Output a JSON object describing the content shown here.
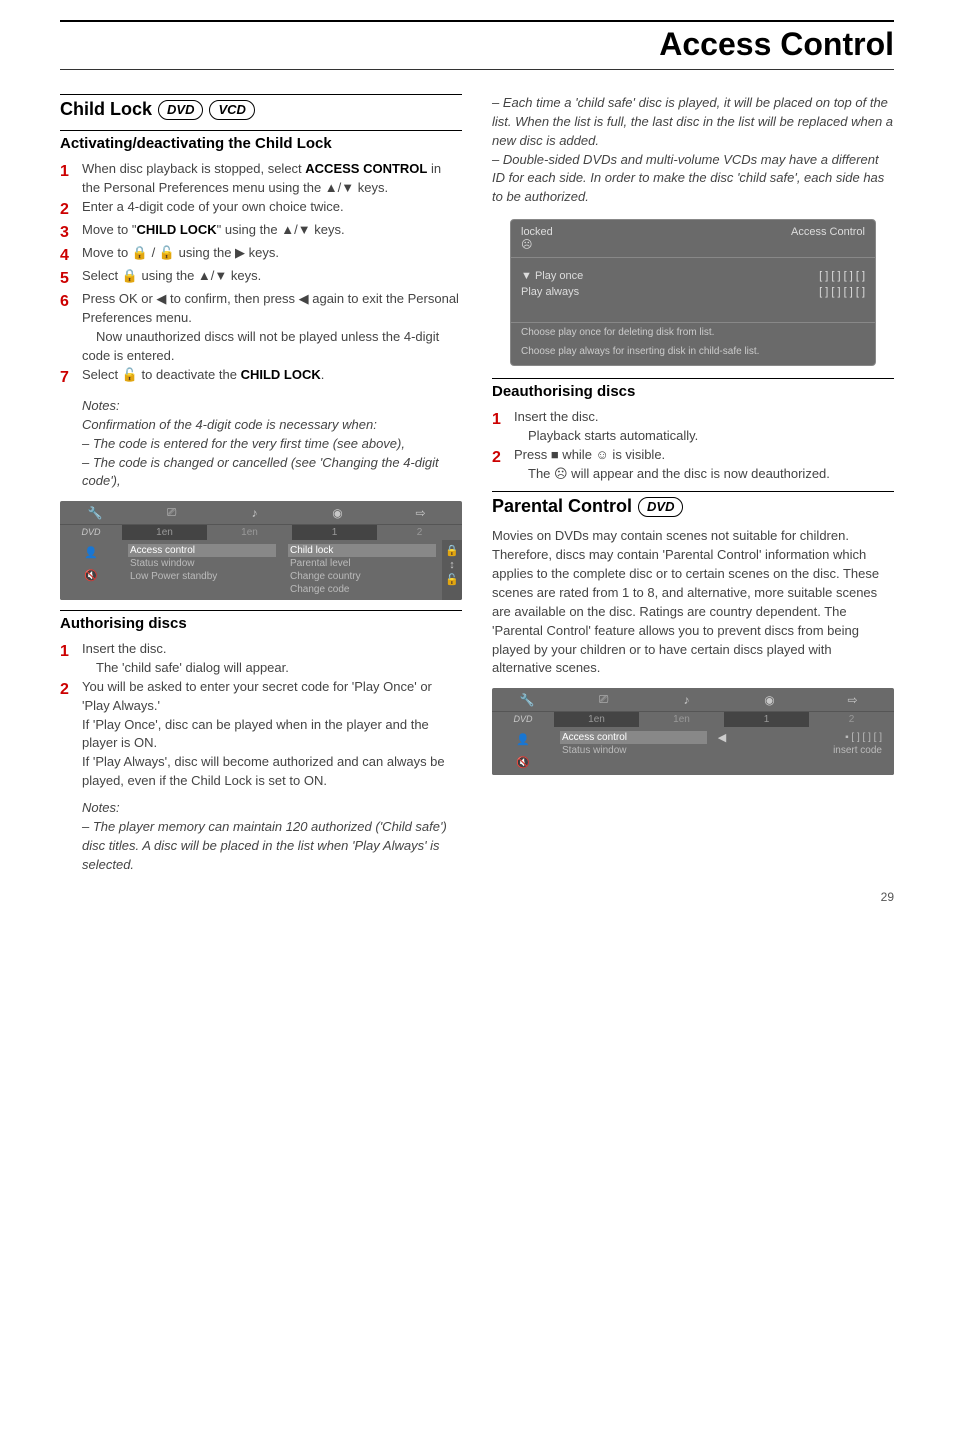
{
  "header": {
    "title": "Access Control"
  },
  "left": {
    "h2": "Child Lock",
    "badges": [
      "DVD",
      "VCD"
    ],
    "h3a": "Activating/deactivating the Child Lock",
    "steps_a": [
      {
        "n": "1",
        "pre": "When disc playback is stopped, select ",
        "b1": "ACCESS CONTROL",
        "post": " in the Personal Preferences menu using the ▲/▼ keys."
      },
      {
        "n": "2",
        "pre": "Enter a 4-digit code of your own choice twice.",
        "b1": "",
        "post": ""
      },
      {
        "n": "3",
        "pre": "Move to \"",
        "b1": "CHILD LOCK",
        "post": "\" using the ▲/▼ keys."
      },
      {
        "n": "4",
        "pre": "Move to 🔒 / 🔓 using the ▶ keys.",
        "b1": "",
        "post": ""
      },
      {
        "n": "5",
        "pre": "Select 🔒 using the ▲/▼ keys.",
        "b1": "",
        "post": ""
      },
      {
        "n": "6",
        "pre": "Press OK or ◀ to confirm, then press ◀ again to exit the Personal Preferences menu.",
        "b1": "",
        "post": "",
        "extra": "Now unauthorized discs will not be played unless the 4-digit code is entered."
      },
      {
        "n": "7",
        "pre": "Select 🔓 to deactivate the ",
        "b1": "CHILD LOCK",
        "post": "."
      }
    ],
    "notes_a_title": "Notes:",
    "notes_a": [
      "Confirmation of the 4-digit code is necessary when:",
      "– The code is entered for the very first time (see above),",
      "– The code is changed or cancelled (see 'Changing the 4-digit code'),"
    ],
    "menu1": {
      "tabs": [
        "1en",
        "1en",
        "1",
        "2"
      ],
      "mid": [
        "Access control",
        "Status window",
        "Low Power standby"
      ],
      "right": [
        "Child lock",
        "Parental level",
        "Change country",
        "Change code"
      ]
    },
    "h3b": "Authorising discs",
    "steps_b": [
      {
        "n": "1",
        "pre": "Insert the disc.",
        "extra": "The 'child safe' dialog will appear."
      },
      {
        "n": "2",
        "pre": "You will be asked to enter your secret code for 'Play Once' or 'Play Always.'",
        "extra2": "If 'Play Once', disc can be played when in the player and the player is ON.\nIf 'Play Always', disc will become authorized and can always be played, even if the Child Lock is set to ON."
      }
    ],
    "notes_b_title": "Notes:",
    "notes_b": [
      "– The player memory can maintain 120 authorized ('Child safe') disc titles. A disc will be placed in the list when 'Play Always' is selected."
    ]
  },
  "right": {
    "cont_notes": [
      "– Each time a 'child safe' disc is played, it will be placed on top of the list. When the list is full, the last disc in the list will be replaced when a new disc is added.",
      "– Double-sided DVDs and multi-volume VCDs may have a different ID for each side. In order to make the disc 'child safe', each side has to be authorized."
    ],
    "dialog": {
      "head_left": "locked",
      "head_right": "Access Control",
      "rows": [
        {
          "l": "▼  Play once",
          "r": "[ ]  [ ]  [ ]  [ ]"
        },
        {
          "l": "    Play always",
          "r": "[ ]  [ ]  [ ]  [ ]"
        }
      ],
      "foot1": "Choose play once for deleting disk from list.",
      "foot2": "Choose play always for inserting disk in child-safe list."
    },
    "h3c": "Deauthorising discs",
    "steps_c": [
      {
        "n": "1",
        "pre": "Insert the disc.",
        "extra": "Playback starts automatically."
      },
      {
        "n": "2",
        "pre": "Press ■ while ☺ is visible.",
        "extra": "The ☹ will appear and the disc is now deauthorized."
      }
    ],
    "h2b": "Parental Control",
    "badges_b": [
      "DVD"
    ],
    "para": "Movies on DVDs may contain scenes not suitable for children. Therefore, discs may contain 'Parental Control' information which applies to the complete disc or to certain scenes on the disc. These scenes are rated from 1 to 8, and alternative, more suitable scenes are available on the disc. Ratings are country dependent. The 'Parental Control' feature allows you to prevent discs from being played by your children or to have certain discs played with alternative scenes.",
    "menu2": {
      "tabs": [
        "1en",
        "1en",
        "1",
        "2"
      ],
      "mid": [
        "Access control",
        "Status window"
      ],
      "right_sub": [
        "▪  [ ]  [ ]  [ ]",
        "insert code"
      ]
    }
  },
  "page_num": "29"
}
